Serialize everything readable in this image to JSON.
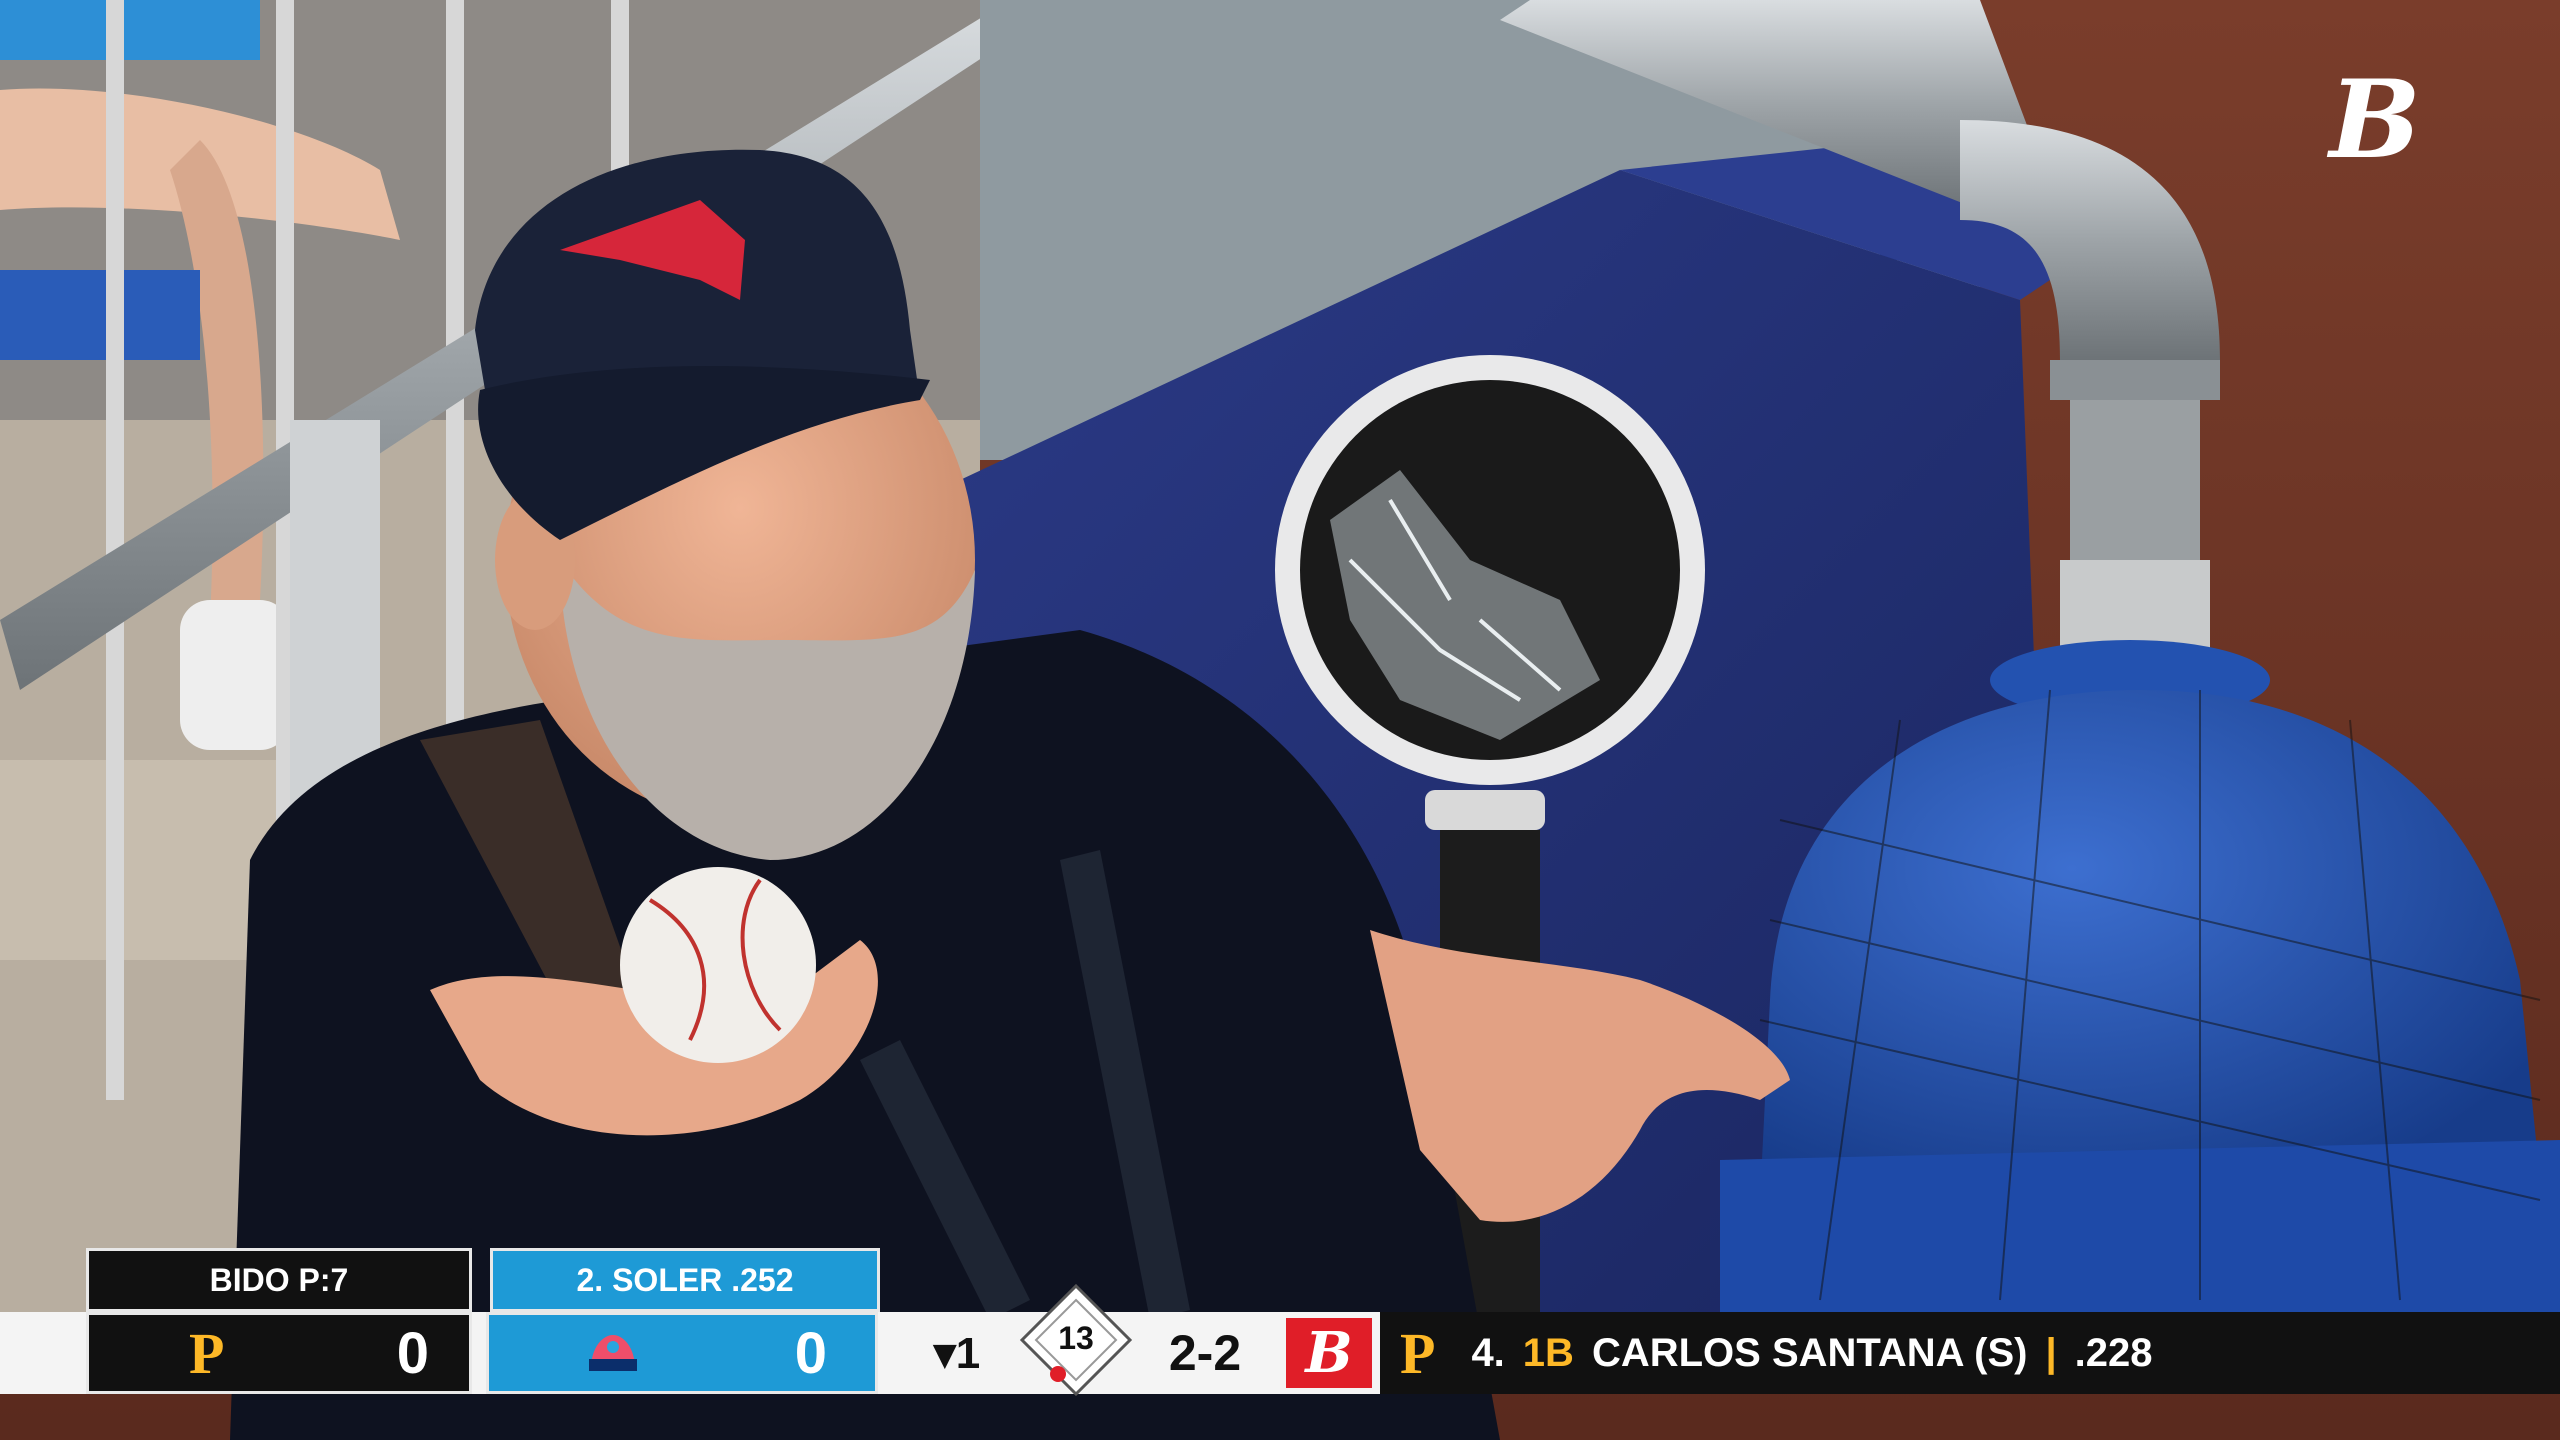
{
  "broadcast_logo": {
    "glyph": "B",
    "icon": "bally-sports-icon"
  },
  "scorebug": {
    "pitcher_label": "BIDO  P:7",
    "batter_on_deck_label": "2. SOLER .252",
    "away_team": {
      "logo": "P",
      "icon": "pirates-logo-icon",
      "score": "0",
      "color": "#111111",
      "accent": "#FDB827"
    },
    "home_team": {
      "icon": "marlins-logo-icon",
      "score": "0",
      "color": "#1EA0D8"
    },
    "inning": "▾1",
    "outs_count": "13",
    "count": "2-2",
    "network_logo": "B",
    "batter_team_logo": "P",
    "batter_number": "4.",
    "batter_position": "1B",
    "batter_name": "CARLOS SANTANA (S)",
    "batter_sep": "|",
    "batter_avg": ".228"
  }
}
